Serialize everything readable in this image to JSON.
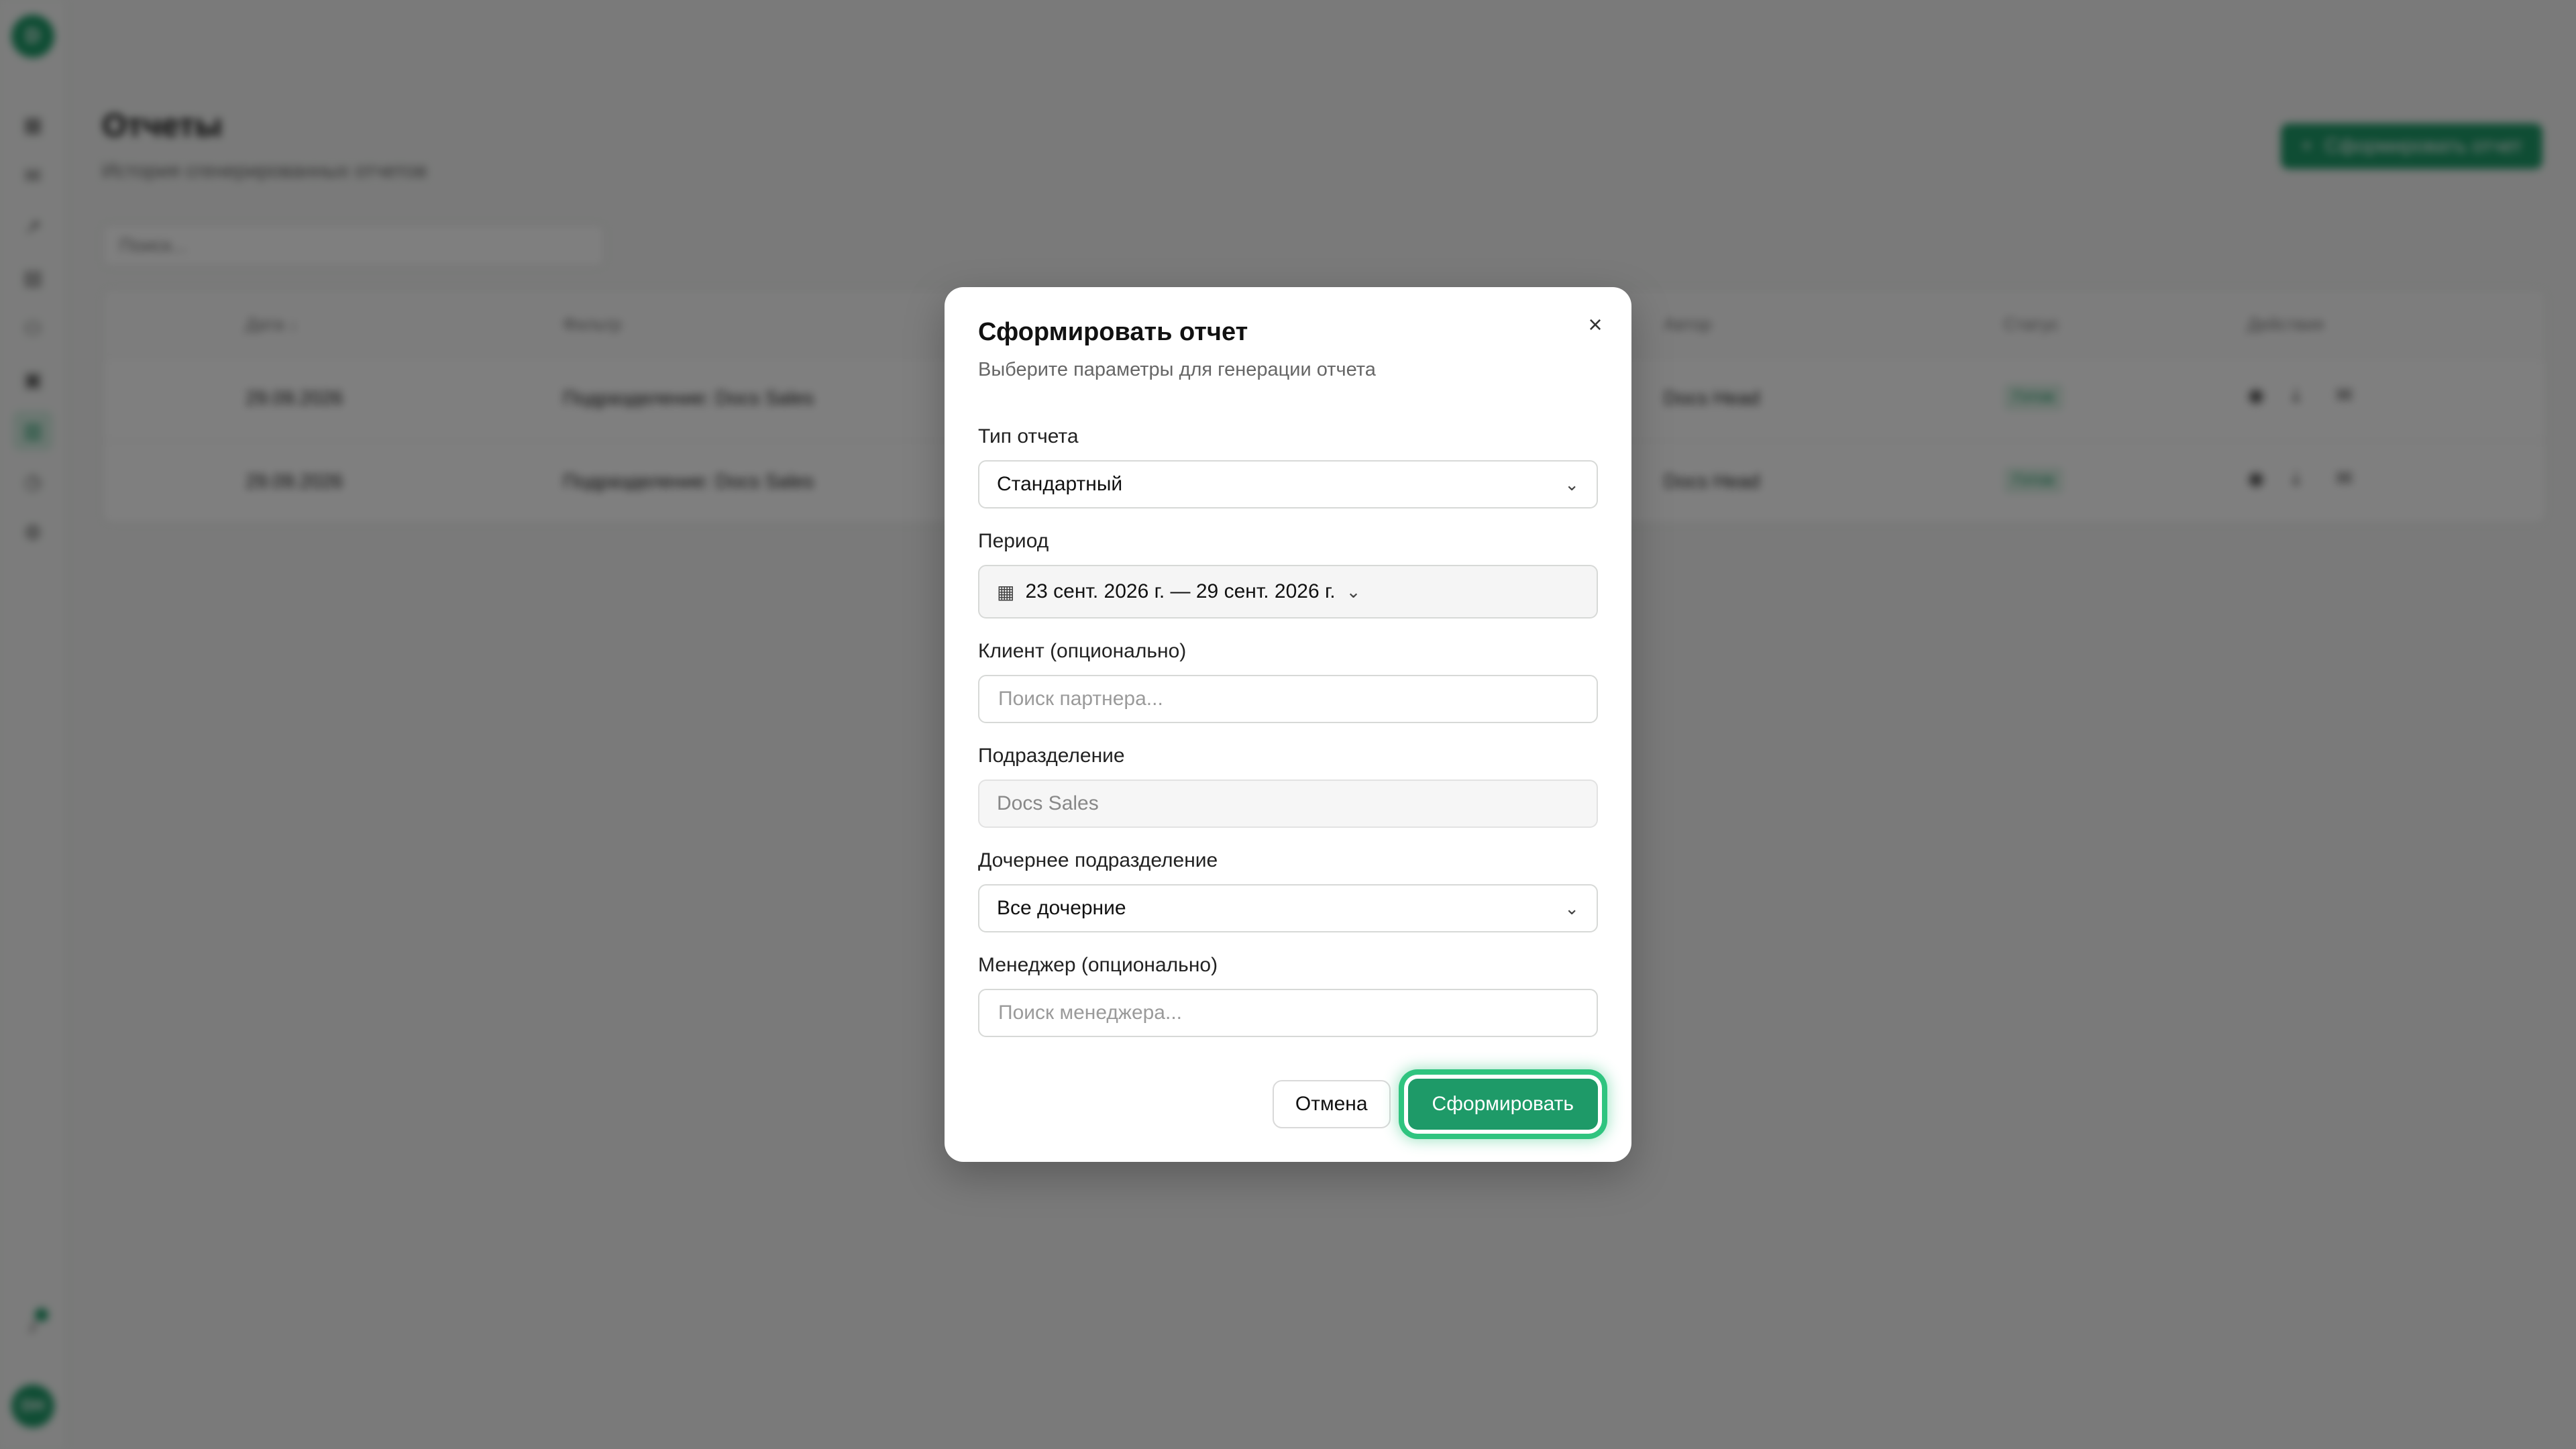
{
  "app": {
    "logo": "D",
    "avatar": "DH",
    "nav_icons": [
      "dashboard-icon",
      "inbox-icon",
      "chart-icon",
      "document-icon",
      "users-icon",
      "calendar-icon",
      "reports-icon",
      "clock-icon",
      "settings-icon"
    ]
  },
  "page": {
    "title": "Отчеты",
    "subtitle": "История сгенерированных отчетов",
    "create_button": "Сформировать отчет",
    "search_placeholder": "Поиск..."
  },
  "table": {
    "headers": [
      "Дата ↓",
      "Фильтр",
      "Автор",
      "Статус",
      "Действия"
    ],
    "rows": [
      {
        "date": "29.09.2026",
        "filter": "Подразделение: Docs Sales",
        "author": "Docs Head",
        "status": "Готов"
      },
      {
        "date": "29.09.2026",
        "filter": "Подразделение: Docs Sales",
        "author": "Docs Head",
        "status": "Готов"
      }
    ]
  },
  "dialog": {
    "title": "Сформировать отчет",
    "subtitle": "Выберите параметры для генерации отчета",
    "report_type": {
      "label": "Тип отчета",
      "value": "Стандартный"
    },
    "period": {
      "label": "Период",
      "value": "23 сент. 2026 г. — 29 сент. 2026 г."
    },
    "client": {
      "label": "Клиент (опционально)",
      "placeholder": "Поиск партнера..."
    },
    "division": {
      "label": "Подразделение",
      "value": "Docs Sales"
    },
    "subdivision": {
      "label": "Дочернее подразделение",
      "value": "Все дочерние"
    },
    "manager": {
      "label": "Менеджер (опционально)",
      "placeholder": "Поиск менеджера..."
    },
    "cancel_button": "Отмена",
    "submit_button": "Сформировать"
  },
  "colors": {
    "accent": "#1e9a68",
    "focus_ring": "#2fc47f",
    "overlay": "rgba(0,0,0,0.5)"
  }
}
